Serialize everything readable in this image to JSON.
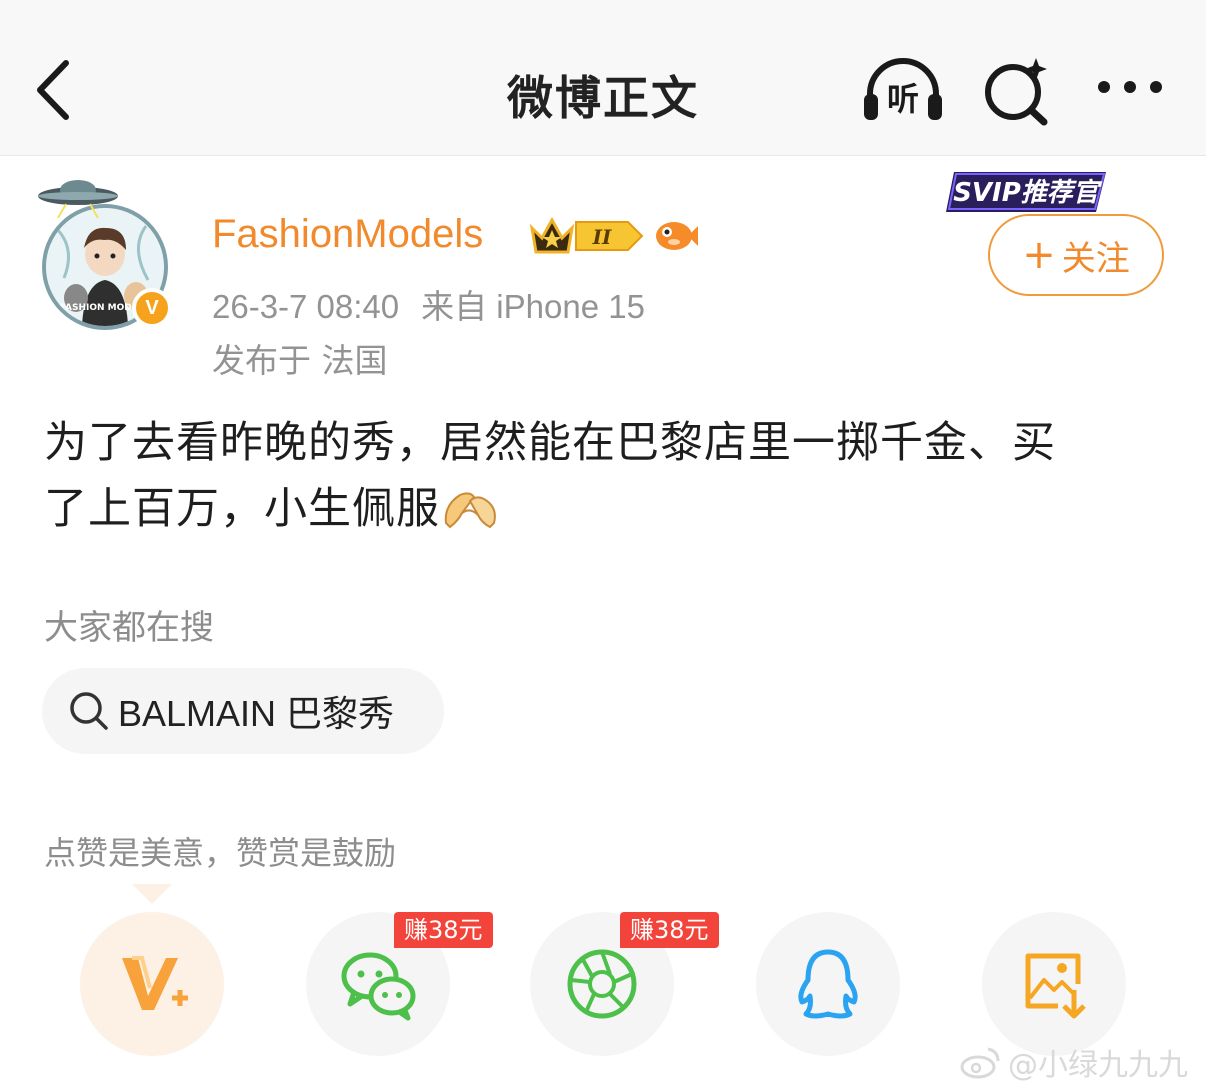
{
  "header": {
    "title": "微博正文",
    "listen_label": "听"
  },
  "author": {
    "name": "FashionModels",
    "time": "26-3-7 08:40",
    "source": "来自 iPhone 15",
    "location": "发布于 法国",
    "verified_mark": "V",
    "svip_label": "SVIP推荐官",
    "level_label": "II",
    "avatar_caption": "FASHION MODELS"
  },
  "follow": {
    "plus": "+",
    "label": "关注"
  },
  "post": {
    "line1": "为了去看昨晚的秀，居然能在巴黎店里一掷千金、买",
    "line2": "了上百万，小生佩服"
  },
  "hot_search": {
    "title": "大家都在搜",
    "item": "BALMAIN 巴黎秀"
  },
  "reward": {
    "hint": "点赞是美意，赞赏是鼓励"
  },
  "share": {
    "earn_wechat": "赚38元",
    "earn_moments": "赚38元"
  },
  "watermark": {
    "text": "@小绿九九九"
  },
  "colors": {
    "accent": "#f08a2c",
    "meta": "#939393",
    "tag_red": "#f2443a",
    "wechat_green": "#4cc04a",
    "qq_blue": "#2aa3f1"
  }
}
